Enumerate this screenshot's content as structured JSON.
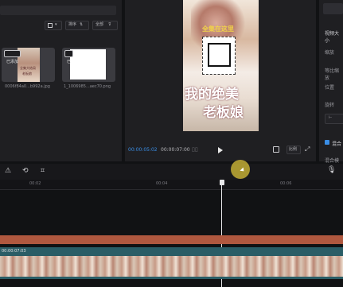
{
  "media": {
    "sort_button_label": "排序",
    "filter_button_label": "全部",
    "items": [
      {
        "name": "0006f84a0...b992a.jpg",
        "badge": "已添加",
        "thumb_title": "全集大结局",
        "thumb_sub": "老板娘"
      },
      {
        "name": "1_1006985...aec70.png",
        "badge": "已"
      }
    ]
  },
  "player": {
    "video_title": "全集在这里",
    "caption_line1": "我的绝美",
    "caption_line2": "老板娘",
    "current_time": "00:00:05:02",
    "total_time": "00:00:07:00",
    "ratio_label": "比例"
  },
  "props": {
    "size_label": "视频大小",
    "scale_label": "缩放",
    "uniform_scale_label": "等比缩放",
    "position_label": "位置",
    "rotate_label": "旋转",
    "mix_label": "混合",
    "blend_mode_label": "混合模式"
  },
  "timeline": {
    "ticks": [
      "00:02",
      "00:04",
      "00:06"
    ],
    "clip_timecode": "00:00:07:03"
  },
  "colors": {
    "accent_blue": "#3a8ee6",
    "audio_track": "#b0583f",
    "video_track": "#2a5d66",
    "cursor_yellow": "#d9c23a"
  }
}
